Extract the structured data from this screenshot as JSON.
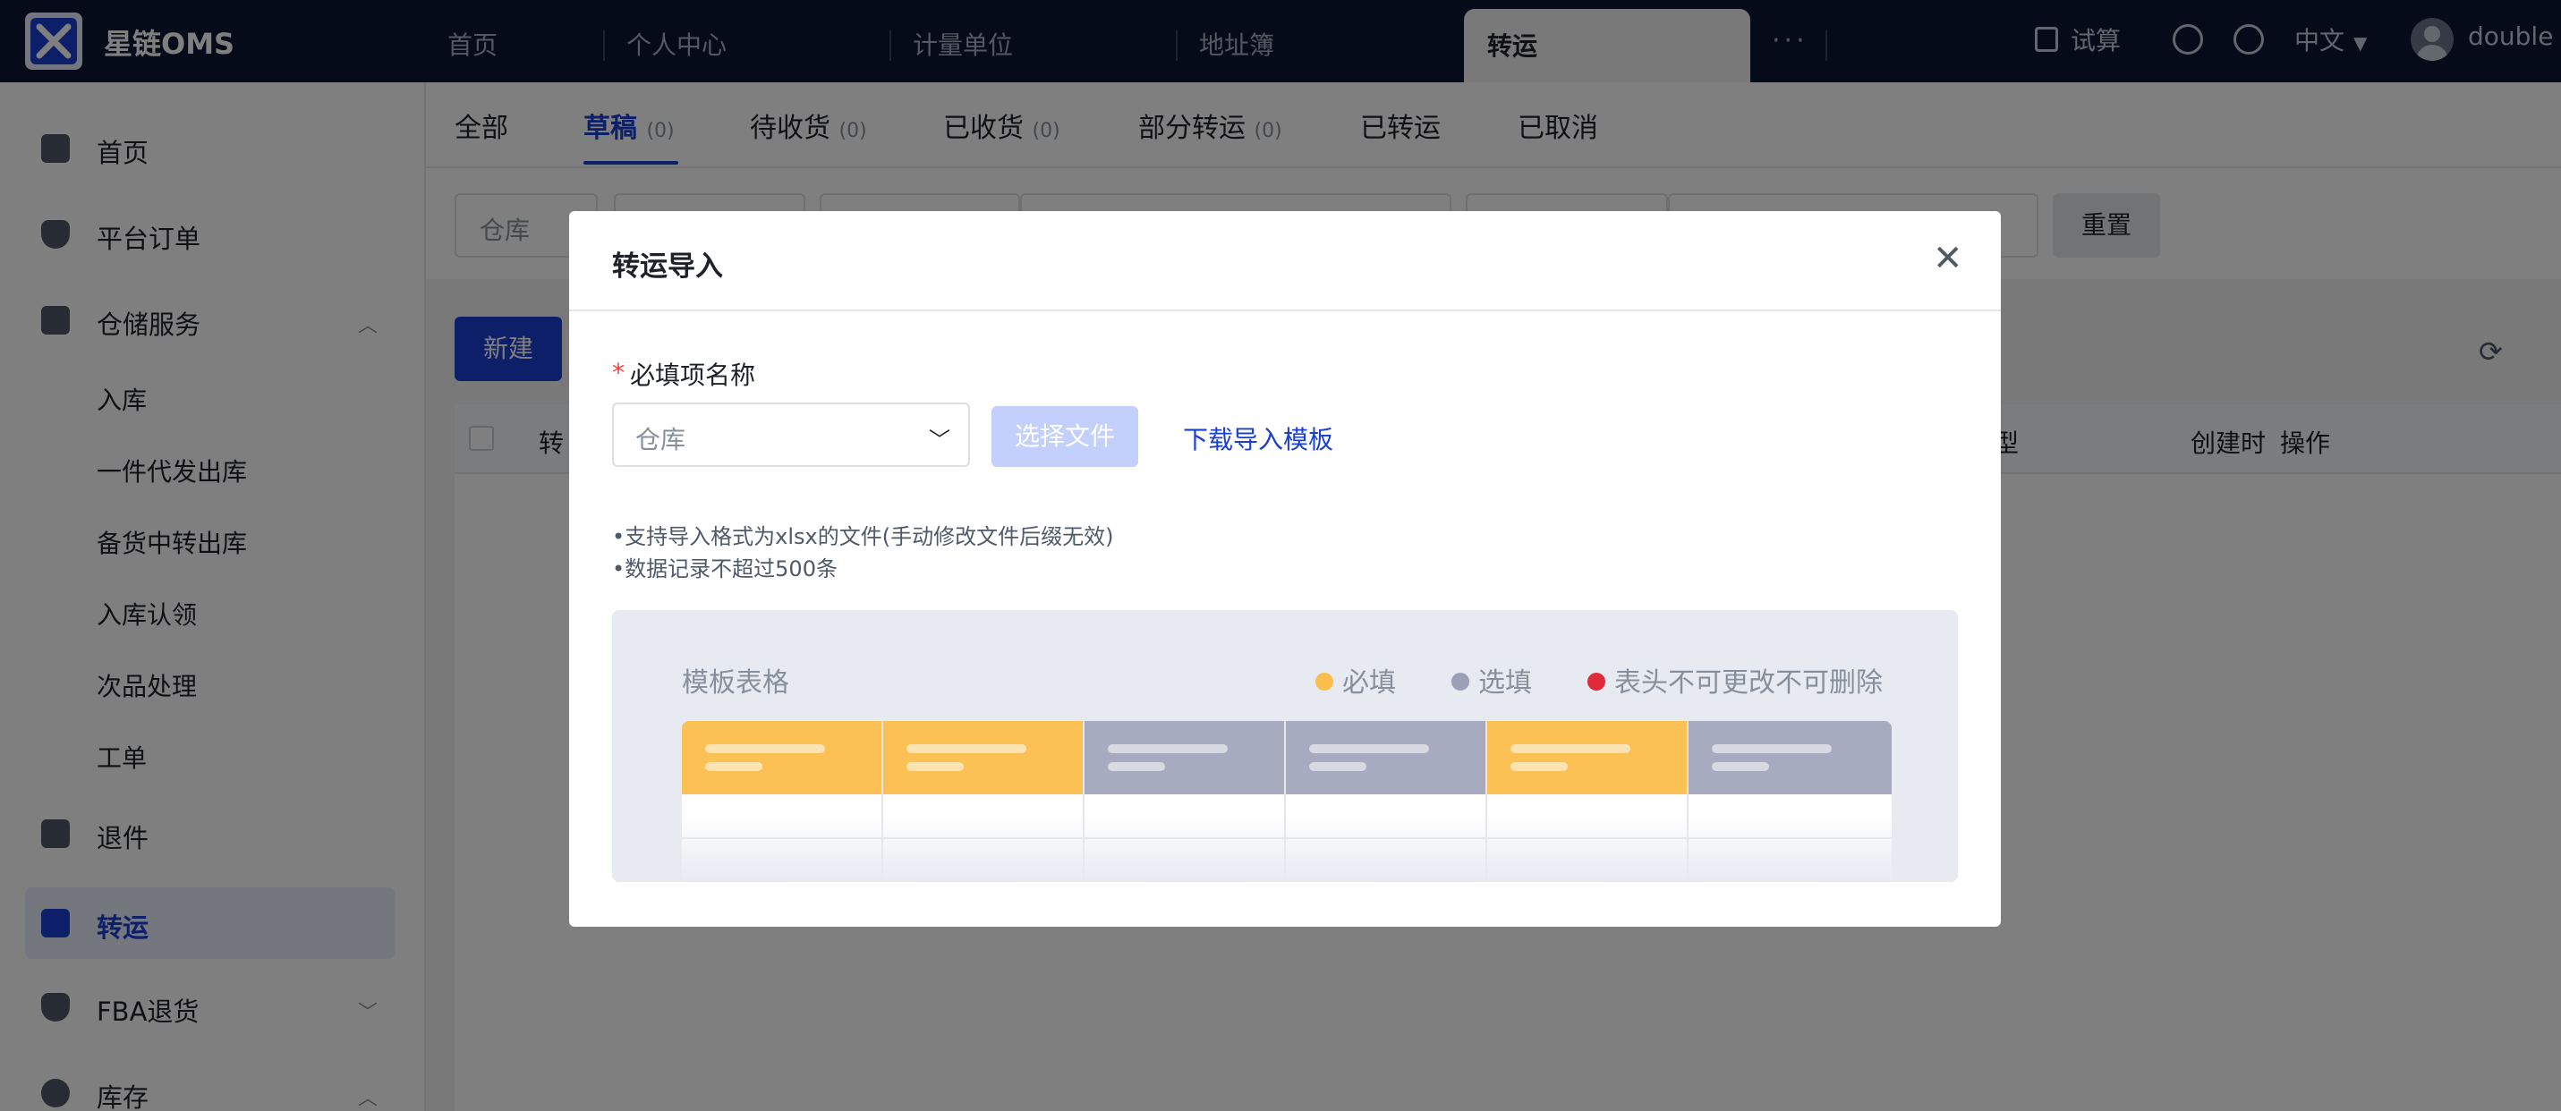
{
  "app": {
    "title": "星链OMS"
  },
  "top_tabs": [
    {
      "label": "首页"
    },
    {
      "label": "个人中心"
    },
    {
      "label": "计量单位"
    },
    {
      "label": "地址簿"
    },
    {
      "label": "转运"
    }
  ],
  "top_more": "···",
  "top_right": {
    "calc_label": "试算",
    "language": "中文",
    "user": "double"
  },
  "sidebar": {
    "items": [
      {
        "label": "首页"
      },
      {
        "label": "平台订单"
      },
      {
        "label": "仓储服务"
      },
      {
        "label": "退件"
      },
      {
        "label": "转运"
      },
      {
        "label": "FBA退货"
      },
      {
        "label": "库存"
      }
    ],
    "sub_items": [
      {
        "label": "入库"
      },
      {
        "label": "一件代发出库"
      },
      {
        "label": "备货中转出库"
      },
      {
        "label": "入库认领"
      },
      {
        "label": "次品处理"
      },
      {
        "label": "工单"
      }
    ]
  },
  "status_tabs": [
    {
      "label": "全部",
      "count": ""
    },
    {
      "label": "草稿",
      "count": "(0)"
    },
    {
      "label": "待收货",
      "count": "(0)"
    },
    {
      "label": "已收货",
      "count": "(0)"
    },
    {
      "label": "部分转运",
      "count": "(0)"
    },
    {
      "label": "已转运",
      "count": ""
    },
    {
      "label": "已取消",
      "count": ""
    }
  ],
  "filters": {
    "warehouse_placeholder": "仓库",
    "reset_label": "重置"
  },
  "toolbar": {
    "new_label": "新建"
  },
  "table": {
    "headers": {
      "col1": "转",
      "col_type": "型",
      "col_created": "创建时",
      "col_ops": "操作"
    }
  },
  "modal": {
    "title": "转运导入",
    "required_label": "必填项名称",
    "required_star": "*",
    "warehouse_placeholder": "仓库",
    "choose_file_label": "选择文件",
    "download_template_label": "下载导入模板",
    "hints": [
      "•支持导入格式为xlsx的文件(手动修改文件后缀无效)",
      "•数据记录不超过500条"
    ],
    "template": {
      "title": "模板表格",
      "legend": [
        {
          "label": "必填",
          "color": "#fbbf4d"
        },
        {
          "label": "选填",
          "color": "#9aa0b5"
        },
        {
          "label": "表头不可更改不可删除",
          "color": "#e02a3a"
        }
      ],
      "column_colors": [
        "#fcc155",
        "#fcc155",
        "#a7abc0",
        "#a7abc0",
        "#fcc155",
        "#a7abc0"
      ]
    }
  },
  "colors": {
    "primary": "#1a3fd3",
    "topbar": "#0b1733"
  }
}
